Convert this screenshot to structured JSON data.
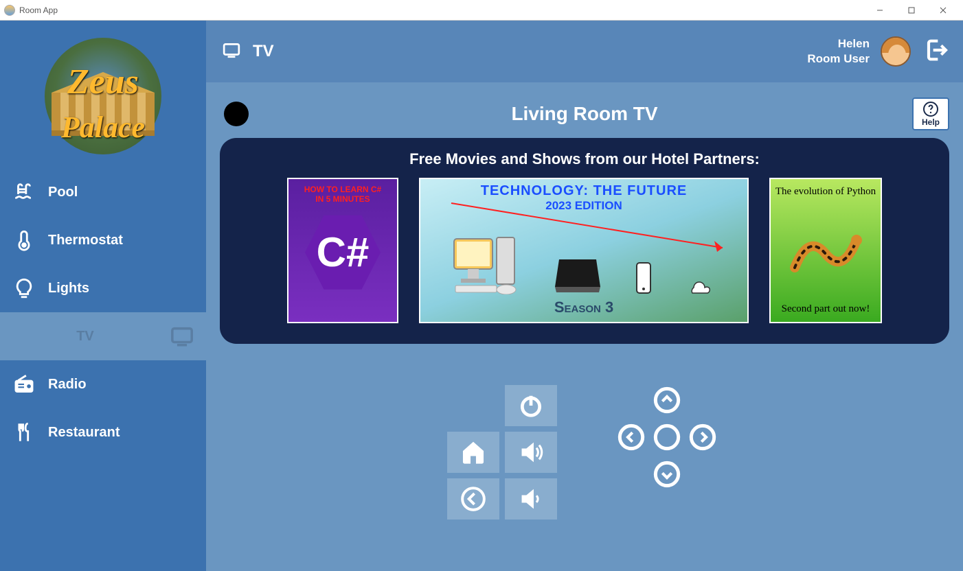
{
  "window": {
    "title": "Room App"
  },
  "brand": {
    "line1": "Zeus",
    "line2": "Palace"
  },
  "sidebar": {
    "items": [
      {
        "id": "pool",
        "label": "Pool"
      },
      {
        "id": "thermostat",
        "label": "Thermostat"
      },
      {
        "id": "lights",
        "label": "Lights"
      },
      {
        "id": "tv",
        "label": "TV",
        "active": true
      },
      {
        "id": "radio",
        "label": "Radio"
      },
      {
        "id": "restaurant",
        "label": "Restaurant"
      }
    ]
  },
  "topbar": {
    "section": "TV",
    "user_name": "Helen",
    "user_role": "Room User"
  },
  "page": {
    "title": "Living Room TV",
    "help_label": "Help"
  },
  "carousel": {
    "heading": "Free Movies and Shows from our Hotel Partners:",
    "items": [
      {
        "title_line1": "HOW TO LEARN C#",
        "title_line2": "IN 5 MINUTES",
        "badge": "C#"
      },
      {
        "title": "TECHNOLOGY: THE FUTURE",
        "subtitle": "2023 EDITION",
        "season": "Season 3"
      },
      {
        "top": "The evolution of Python",
        "bottom": "Second part out now!"
      }
    ]
  },
  "remote": {
    "power": "Power",
    "home": "Home",
    "vol_up": "Volume Up",
    "back": "Back",
    "vol_down": "Volume Down",
    "up": "Up",
    "down": "Down",
    "left": "Left",
    "right": "Right",
    "ok": "OK"
  }
}
